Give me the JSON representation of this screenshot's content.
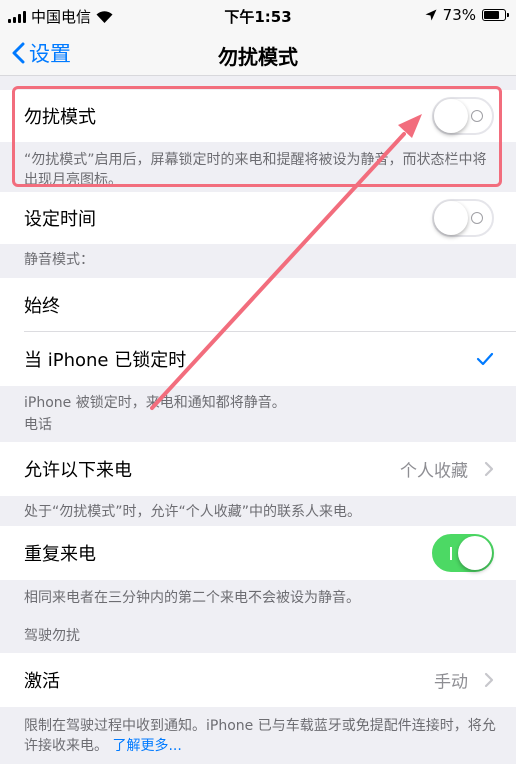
{
  "status": {
    "carrier": "中国电信",
    "time": "下午1:53",
    "battery": "73%",
    "battery_level": 0.73
  },
  "nav": {
    "back_label": "设置",
    "title": "勿扰模式"
  },
  "dnd": {
    "label": "勿扰模式",
    "enabled": false,
    "note": "“勿扰模式”启用后，屏幕锁定时的来电和提醒将被设为静音，而状态栏中将出现月亮图标。"
  },
  "schedule": {
    "label": "设定时间",
    "enabled": false
  },
  "silence": {
    "header": "静音模式：",
    "options": [
      {
        "label": "始终",
        "checked": false
      },
      {
        "label": "当 iPhone 已锁定时",
        "checked": true
      }
    ],
    "note": "iPhone 被锁定时，来电和通知都将静音。"
  },
  "phone": {
    "header": "电话",
    "allow_calls": {
      "label": "允许以下来电",
      "value": "个人收藏"
    },
    "allow_note": "处于“勿扰模式”时，允许“个人收藏”中的联系人来电。",
    "repeated": {
      "label": "重复来电",
      "enabled": true
    },
    "repeated_note": "相同来电者在三分钟内的第二个来电不会被设为静音。"
  },
  "driving": {
    "header": "驾驶勿扰",
    "activate": {
      "label": "激活",
      "value": "手动"
    },
    "note": "限制在驾驶过程中收到通知。iPhone 已与车载蓝牙或免提配件连接时，将允许接收来电。",
    "link": "了解更多..."
  },
  "colors": {
    "accent": "#007aff",
    "toggle_on": "#4cd964",
    "annotation": "#f26d7d"
  }
}
